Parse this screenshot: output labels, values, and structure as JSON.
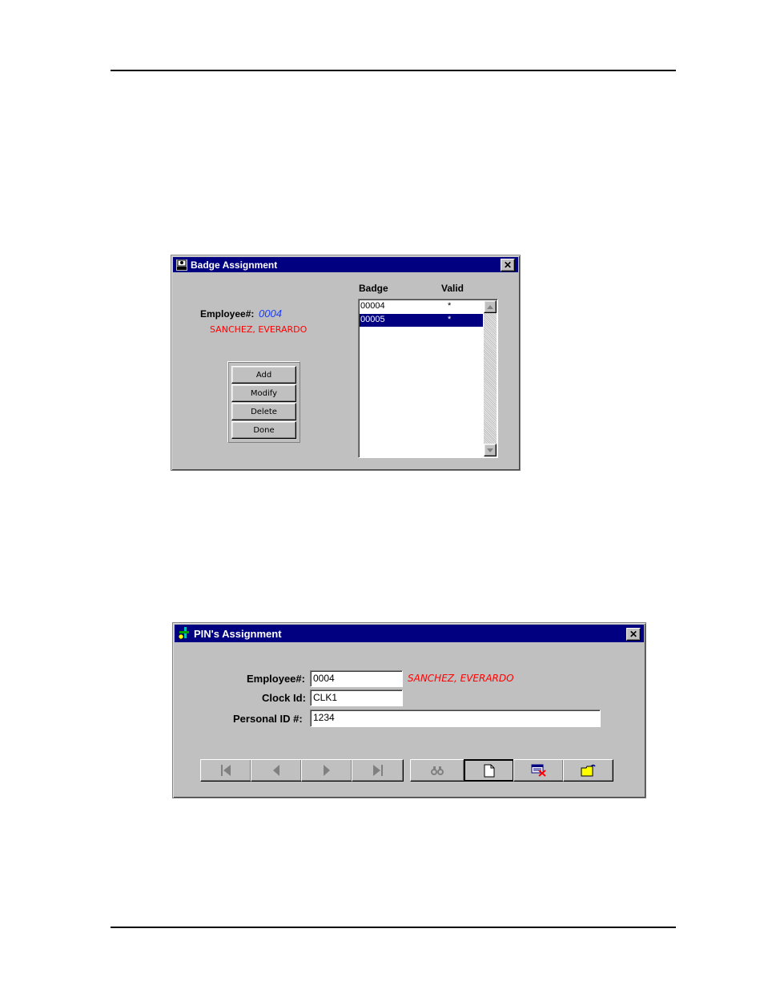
{
  "badge_window": {
    "title": "Badge Assignment",
    "employee_label": "Employee#:",
    "employee_number": "0004",
    "employee_name": "SANCHEZ, EVERARDO",
    "buttons": {
      "add": "Add",
      "modify": "Modify",
      "delete": "Delete",
      "done": "Done"
    },
    "columns": {
      "badge": "Badge",
      "valid": "Valid"
    },
    "rows": [
      {
        "badge": "00004",
        "valid": "*",
        "selected": false
      },
      {
        "badge": "00005",
        "valid": "*",
        "selected": true
      }
    ],
    "colors": {
      "employee_number": "#1a3cff",
      "employee_name": "#ff0000",
      "selection": "#000080"
    },
    "title_icon": "badge-assignment-icon"
  },
  "pin_window": {
    "title": "PIN's Assignment",
    "employee_label": "Employee#:",
    "employee_value": "0004",
    "employee_name": "SANCHEZ, EVERARDO",
    "clock_label": "Clock Id:",
    "clock_value": "CLK1",
    "pin_label": "Personal ID #:",
    "pin_value": "1234",
    "toolbar_icons": [
      "first-record-icon",
      "previous-record-icon",
      "next-record-icon",
      "last-record-icon",
      "find-icon",
      "new-record-icon",
      "delete-record-icon",
      "open-icon"
    ],
    "colors": {
      "employee_name": "#ff0000"
    },
    "title_icon": "pin-assignment-icon"
  }
}
